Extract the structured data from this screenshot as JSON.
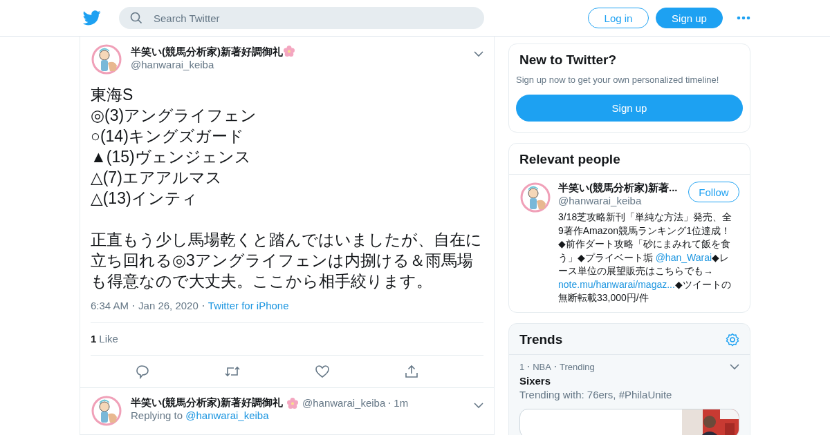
{
  "header": {
    "search": {
      "placeholder": "Search Twitter"
    },
    "buttons": [
      {
        "label": "Log in",
        "kind": "outline"
      },
      {
        "label": "Sign up",
        "kind": "filled"
      }
    ]
  },
  "tweet": {
    "name": "半笑い(競馬分析家)新著好調御礼",
    "handle": "@hanwarai_keiba",
    "lines": [
      "東海S",
      "◎(3)アングライフェン",
      "○(14)キングズガード",
      "▲(15)ヴェンジェンス",
      "△(7)エアアルマス",
      "△(13)インティ"
    ],
    "paragraph": "正直もう少し馬場乾くと踏んではいましたが、自在に立ち回れる◎3アングライフェンは内捌ける＆雨馬場も得意なので大丈夫。ここから相手絞ります。",
    "time": "6:34 AM",
    "date": "Jan 26, 2020",
    "source": "Twitter for iPhone",
    "like_count": "1",
    "like_label": "Like"
  },
  "reply": {
    "name": "半笑い(競馬分析家)新著好調御礼",
    "handle": "@hanwarai_keiba",
    "time": "1m",
    "replying_label": "Replying to",
    "replying_to": "@hanwarai_keiba"
  },
  "signup_card": {
    "title": "New to Twitter?",
    "text": "Sign up now to get your own personalized timeline!",
    "button": "Sign up"
  },
  "relevant_people": {
    "title": "Relevant people",
    "name": "半笑い(競馬分析家)新著...",
    "handle": "@hanwarai_keiba",
    "button": "Follow",
    "bio": [
      {
        "kind": "text",
        "text": "3/18芝攻略新刊「単純な方法」発売、全9著作Amazon競馬ランキング1位達成！◆前作ダート攻略「砂にまみれて飯を食う」◆プライベート垢 "
      },
      {
        "kind": "link",
        "text": "@han_Warai"
      },
      {
        "kind": "text",
        "text": "◆レース単位の展望販売はこちらでも→ "
      },
      {
        "kind": "link",
        "text": "note.mu/hanwarai/magaz..."
      },
      {
        "kind": "text",
        "text": "◆ツイートの無断転載33,000円/件"
      }
    ]
  },
  "trends": {
    "title": "Trends",
    "items": [
      {
        "rank": "1",
        "category": "NBA",
        "status": "Trending",
        "name": "Sixers",
        "context": "Trending with: 76ers, #PhilaUnite"
      }
    ]
  }
}
